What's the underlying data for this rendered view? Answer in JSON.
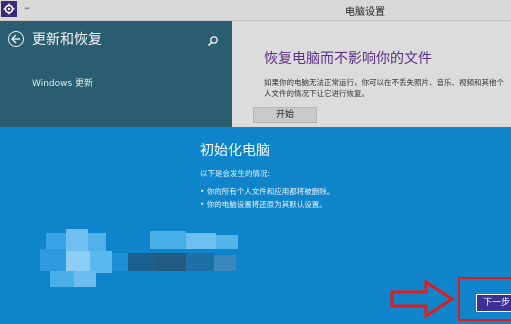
{
  "window": {
    "title": "电脑设置"
  },
  "nav": {
    "title": "更新和恢复",
    "items": [
      {
        "label": "Windows 更新"
      }
    ]
  },
  "content": {
    "heading": "恢复电脑而不影响你的文件",
    "description": "如果你的电脑无法正常运行，你可以在不丢失照片、音乐、视频和其他个人文件的情况下让它进行恢复。",
    "start_label": "开始"
  },
  "dialog": {
    "title": "初始化电脑",
    "intro": "以下是会发生的情况:",
    "bullets": [
      "• 你的所有个人文件和应用都将被删除。",
      "• 你的电脑设置将还原为其默认设置。"
    ],
    "next_label": "下一步"
  },
  "colors": {
    "nav_bg": "#2b5d70",
    "content_bg": "#dcdcdc",
    "accent_purple": "#5e2f8a",
    "dialog_bg": "#0f84cb",
    "next_button": "#3e2f96",
    "highlight_red": "#e01c1c"
  },
  "icons": [
    "settings-gear-icon",
    "back-arrow-icon",
    "search-icon",
    "right-arrow-icon"
  ]
}
